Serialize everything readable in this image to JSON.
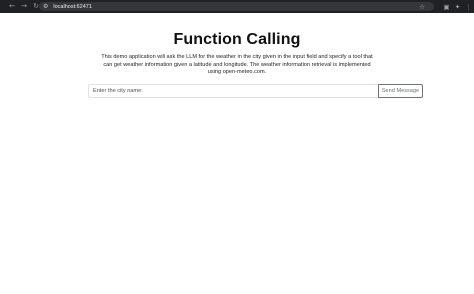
{
  "browser": {
    "url": "localhost:62471",
    "icons": {
      "back": "back-arrow-icon",
      "forward": "forward-arrow-icon",
      "reload": "reload-icon",
      "site_info": "site-info-icon",
      "bookmark": "star-icon",
      "profile": "profile-icon",
      "extensions": "puzzle-icon",
      "menu": "kebab-menu-icon"
    }
  },
  "page": {
    "title": "Function Calling",
    "description": "This demo application will ask the LLM for the weather in the city given in the input field and specify a tool that can get weather information given a latitude and longitude. The weather information retrieval is implemented using open-meteo.com.",
    "city_input": {
      "value": "",
      "placeholder": "Enter the city name:"
    },
    "send_label": "Send Message"
  }
}
